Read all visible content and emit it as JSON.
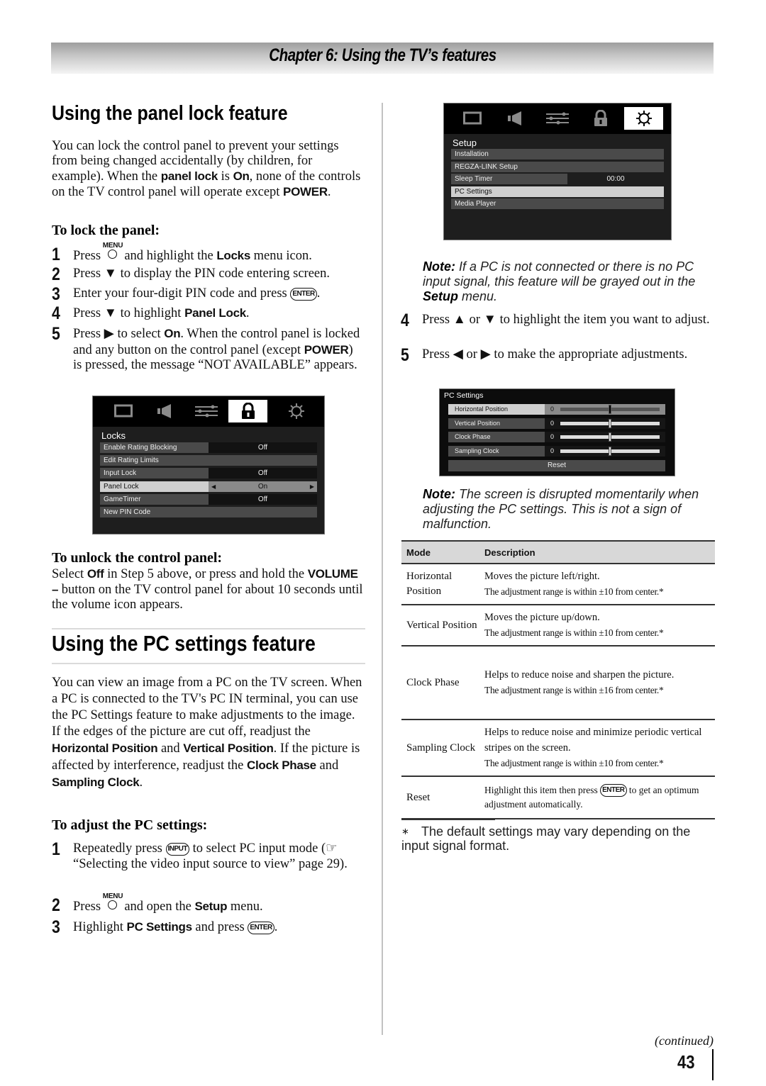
{
  "chapter": "Chapter 6: Using the TV’s features",
  "panel_lock": {
    "heading": "Using the panel lock feature",
    "intro": [
      "You can lock the control panel to prevent your settings from being changed accidentally (by children, for example). When the ",
      "panel lock",
      " is ",
      "On",
      ", none of the controls on the TV control panel will operate except ",
      "POWER",
      "."
    ],
    "lock_heading": "To lock the panel:",
    "steps": [
      {
        "num": "1",
        "parts": [
          "Press ",
          "[MENU]",
          " and highlight the ",
          "Locks",
          " menu icon."
        ]
      },
      {
        "num": "2",
        "parts": [
          "Press ▼ to display the PIN code entering screen."
        ]
      },
      {
        "num": "3",
        "parts": [
          "Enter your four-digit PIN code and press ",
          "[ENTER]",
          "."
        ]
      },
      {
        "num": "4",
        "parts": [
          "Press ▼ to highlight ",
          "Panel Lock",
          "."
        ]
      },
      {
        "num": "5",
        "parts": [
          "Press ▶ to select ",
          "On",
          ". When the control panel is locked and any button on the control panel (except ",
          "POWER",
          ") is pressed, the message “NOT AVAILABLE” appears."
        ]
      }
    ],
    "unlock_heading": "To unlock the control panel:",
    "unlock_text": [
      "Select ",
      "Off",
      " in Step 5 above, or press and hold the ",
      "VOLUME –",
      " button on the TV control panel for about 10 seconds until the volume icon appears."
    ]
  },
  "locks_screen": {
    "icons": [
      "picture-icon",
      "sound-icon",
      "preferences-icon",
      "lock-icon",
      "setup-gear-icon"
    ],
    "selected_icon": 3,
    "title": "Locks",
    "rows": [
      {
        "label": "Enable Rating Blocking",
        "value": "Off"
      },
      {
        "label": "Edit Rating Limits",
        "value": ""
      },
      {
        "label": "Input Lock",
        "value": "Off"
      },
      {
        "label": "Panel Lock",
        "value": "On",
        "selected": true
      },
      {
        "label": "GameTimer",
        "value": "Off"
      },
      {
        "label": "New PIN Code",
        "value": ""
      }
    ]
  },
  "pc_settings": {
    "heading": "Using the PC settings feature",
    "intro": [
      "You can view an image from a PC on the TV screen. When a PC is connected to the TV's PC IN terminal, you can use the PC Settings feature to make adjustments to the image. If the edges of the picture are cut off, readjust the ",
      "Horizontal Position",
      " and ",
      "Vertical Position",
      ". If the picture is affected by interference, readjust the ",
      "Clock Phase",
      " and ",
      "Sampling Clock",
      "."
    ],
    "adjust_heading": "To adjust the PC settings:",
    "steps": [
      {
        "num": "1",
        "parts": [
          "Repeatedly press ",
          "[INPUT]",
          " to select PC input mode (☞ “Selecting the video input source to view” page 29)."
        ]
      },
      {
        "num": "2",
        "parts": [
          "Press ",
          "[MENU]",
          " and open the ",
          "Setup",
          " menu."
        ]
      },
      {
        "num": "3",
        "parts": [
          "Highlight ",
          "PC Settings",
          " and press ",
          "[ENTER]",
          "."
        ]
      },
      {
        "num": "4",
        "parts": [
          "Press ▲ or ▼ to highlight the item you want to adjust."
        ]
      },
      {
        "num": "5",
        "parts": [
          "Press ◀ or ▶ to make the appropriate adjustments."
        ]
      }
    ],
    "note1": {
      "label": "Note:",
      "text": " If a PC is not connected or there is no PC input signal, this feature will be grayed out in the ",
      "bold": "Setup",
      "tail": " menu."
    },
    "note2": {
      "label": "Note:",
      "text": " The screen is disrupted momentarily when adjusting the PC settings. This is not a sign of malfunction."
    }
  },
  "setup_screen": {
    "selected_icon": 4,
    "title": "Setup",
    "rows": [
      {
        "label": "Installation",
        "value": ""
      },
      {
        "label": "REGZA-LINK Setup",
        "value": ""
      },
      {
        "label": "Sleep Timer",
        "value": "00:00"
      },
      {
        "label": "PC Settings",
        "value": "",
        "selected": true
      },
      {
        "label": "Media Player",
        "value": ""
      }
    ]
  },
  "pc_screen": {
    "title": "PC Settings",
    "rows": [
      {
        "label": "Horizontal Position",
        "value": "0",
        "slider_fraction": 0.5,
        "selected": true
      },
      {
        "label": "Vertical Position",
        "value": "0",
        "slider_fraction": 0.5
      },
      {
        "label": "Clock Phase",
        "value": "0",
        "slider_fraction": 0.5
      },
      {
        "label": "Sampling Clock",
        "value": "0",
        "slider_fraction": 0.5
      }
    ],
    "reset": "Reset"
  },
  "table": {
    "headers": [
      "Mode",
      "Description"
    ],
    "rows": [
      {
        "mode": "Horizontal Position",
        "desc": "Moves the picture left/right.",
        "range": "The adjustment range is within ±10 from center.*"
      },
      {
        "mode": "Vertical Position",
        "desc": "Moves the picture up/down.",
        "range": "The adjustment range is within ±10 from center.*"
      },
      {
        "mode": "Clock Phase",
        "desc": "Helps to reduce noise and sharpen the picture.",
        "range": "The adjustment range is within ±16 from center.*"
      },
      {
        "mode": "Sampling Clock",
        "desc": "Helps to reduce noise and minimize periodic vertical stripes on the screen.",
        "range": "The adjustment range is within ±10 from center.*"
      },
      {
        "mode": "Reset",
        "desc": "Highlight this item then press [ENTER] to get an optimum adjustment automatically.",
        "range": ""
      }
    ]
  },
  "footnote": {
    "mark": "∗",
    "text": "The default settings may vary depending on the input signal format."
  },
  "continued": "(continued)",
  "page_number": "43"
}
